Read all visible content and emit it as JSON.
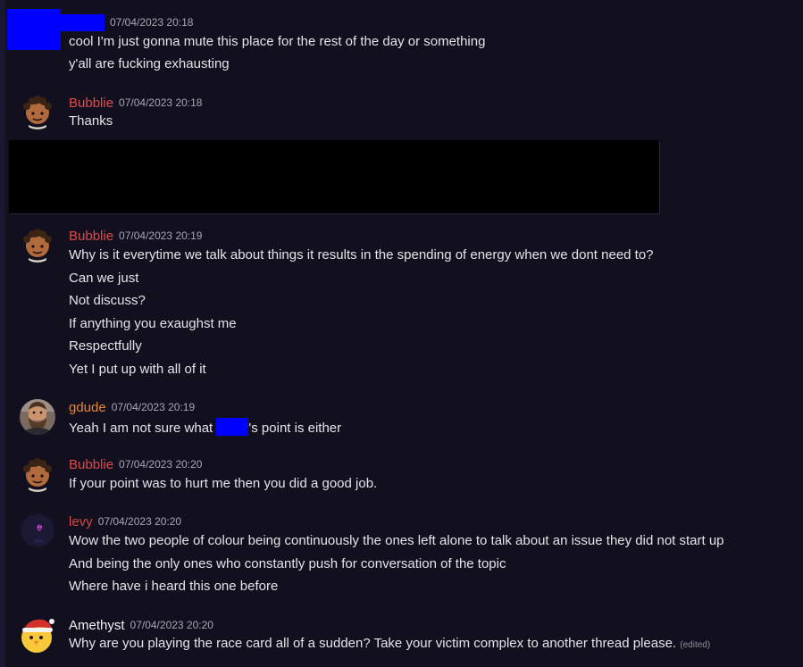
{
  "colors": {
    "background": "#120f1f",
    "bubblie": "#e04a4a",
    "gdude": "#e5882f",
    "levy": "#d64545",
    "amethyst": "#f2f3f5",
    "redaction_blue": "#0000ff",
    "redaction_black": "#000000"
  },
  "messages": [
    {
      "username": "",
      "timestamp": "07/04/2023 20:18",
      "lines": [
        "cool I'm just gonna mute this place for the rest of the day or something",
        "y'all are fucking exhausting"
      ]
    },
    {
      "username": "Bubblie",
      "timestamp": "07/04/2023 20:18",
      "lines": [
        "Thanks"
      ]
    },
    {
      "username": "Bubblie",
      "timestamp": "07/04/2023 20:19",
      "lines": [
        "Why is it everytime we talk about things it results in the spending of energy when we dont need to?",
        "Can we just",
        "Not discuss?",
        "If anything you exaughst me",
        "Respectfully",
        "Yet I put up with all of it"
      ]
    },
    {
      "username": "gdude",
      "timestamp": "07/04/2023 20:19",
      "lines": [
        "Yeah I am not sure what ",
        "'s point is either"
      ]
    },
    {
      "username": "Bubblie",
      "timestamp": "07/04/2023 20:20",
      "lines": [
        "If your point was to hurt me then you did a good job."
      ]
    },
    {
      "username": "levy",
      "timestamp": "07/04/2023 20:20",
      "lines": [
        "Wow the two people of colour being continuously the ones left alone to talk about an issue they did not start up",
        "And being the only ones who constantly push for conversation of the topic",
        "Where have i heard this one before"
      ]
    },
    {
      "username": "Amethyst",
      "timestamp": "07/04/2023 20:20",
      "lines": [
        "Why are you playing the race card all of a sudden? Take your victim complex to another thread please."
      ],
      "edited_label": "(edited)"
    }
  ],
  "icons": {
    "bubblie_avatar": "curly-hair-face-icon",
    "gdude_avatar": "bearded-man-icon",
    "levy_avatar": "dark-figure-icon",
    "amethyst_avatar": "santa-hat-chick-icon"
  }
}
